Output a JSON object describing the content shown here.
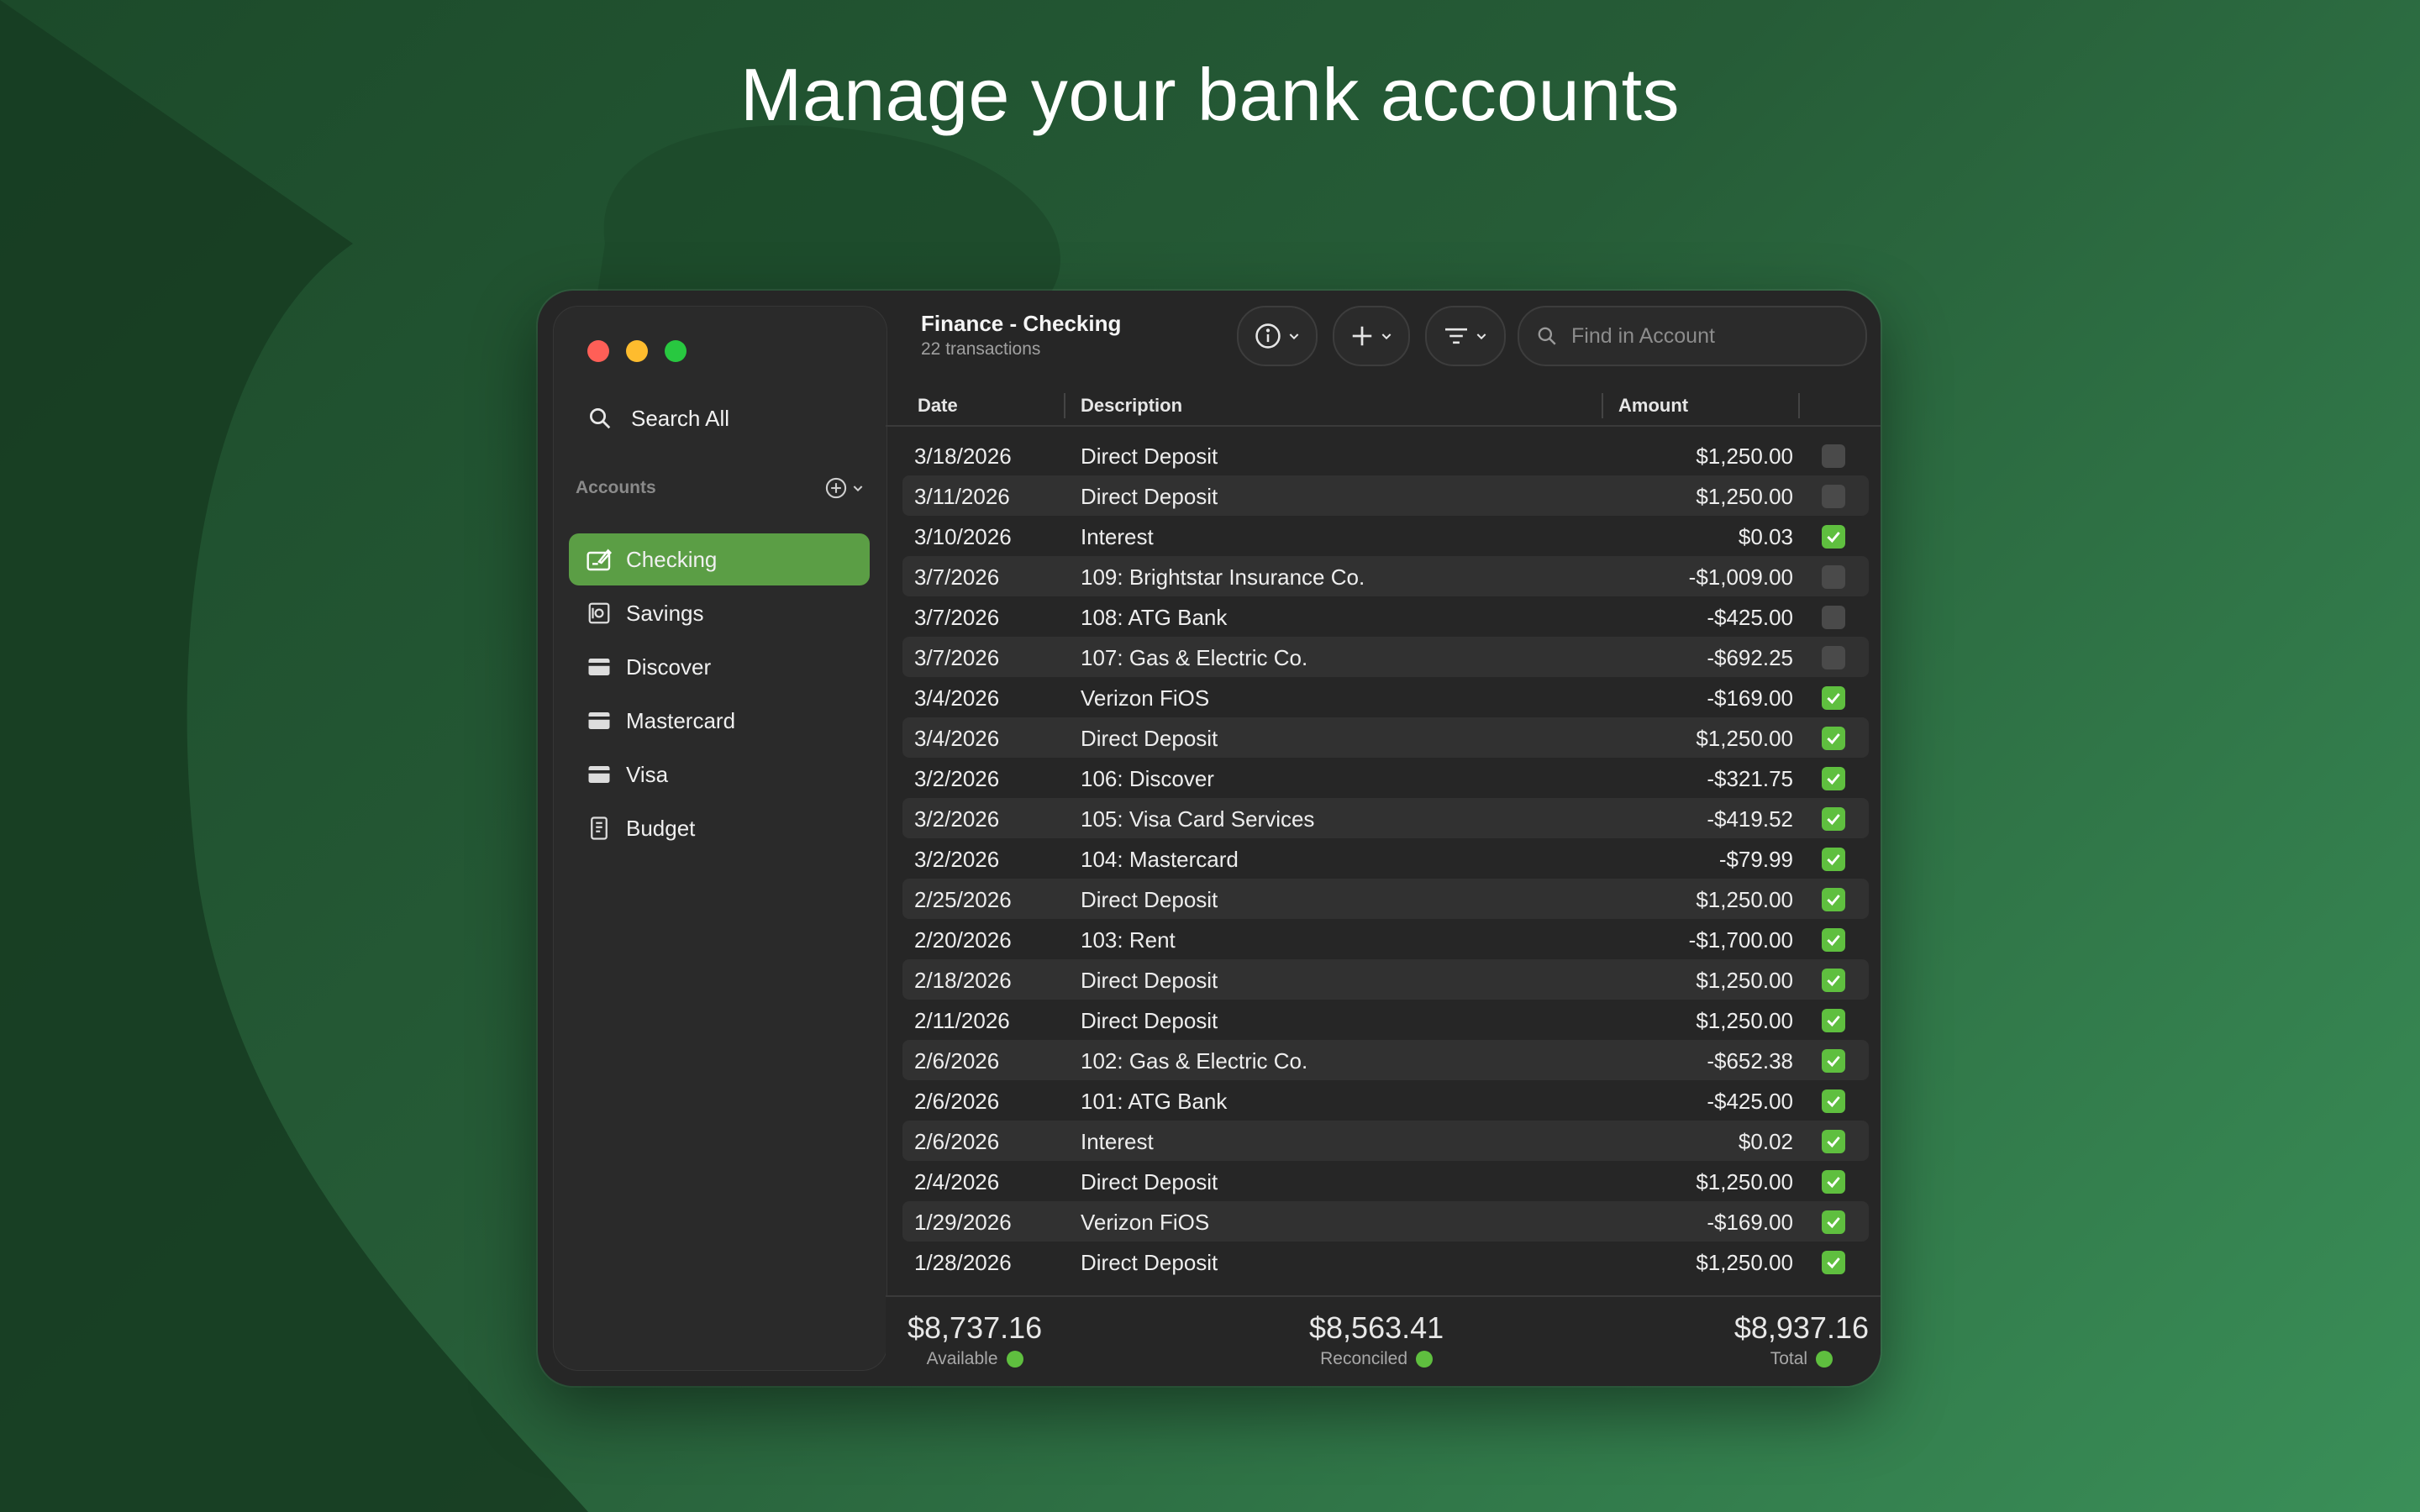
{
  "headline": "Manage your bank accounts",
  "window": {
    "title": "Finance - Checking",
    "subtitle": "22 transactions"
  },
  "sidebar": {
    "search_all": "Search All",
    "section_label": "Accounts",
    "accounts": [
      {
        "label": "Checking",
        "icon": "checkbook-icon",
        "active": true
      },
      {
        "label": "Savings",
        "icon": "safe-icon"
      },
      {
        "label": "Discover",
        "icon": "credit-card-icon"
      },
      {
        "label": "Mastercard",
        "icon": "credit-card-icon"
      },
      {
        "label": "Visa",
        "icon": "credit-card-icon"
      },
      {
        "label": "Budget",
        "icon": "budget-sheet-icon"
      }
    ]
  },
  "toolbar": {
    "search_placeholder": "Find in Account"
  },
  "table": {
    "columns": [
      "Date",
      "Description",
      "Amount"
    ],
    "rows": [
      {
        "date": "3/18/2026",
        "desc": "Direct Deposit",
        "amount": "$1,250.00",
        "cleared": false
      },
      {
        "date": "3/11/2026",
        "desc": "Direct Deposit",
        "amount": "$1,250.00",
        "cleared": false
      },
      {
        "date": "3/10/2026",
        "desc": "Interest",
        "amount": "$0.03",
        "cleared": true
      },
      {
        "date": "3/7/2026",
        "desc": "109: Brightstar Insurance Co.",
        "amount": "-$1,009.00",
        "cleared": false
      },
      {
        "date": "3/7/2026",
        "desc": "108: ATG Bank",
        "amount": "-$425.00",
        "cleared": false
      },
      {
        "date": "3/7/2026",
        "desc": "107: Gas & Electric Co.",
        "amount": "-$692.25",
        "cleared": false
      },
      {
        "date": "3/4/2026",
        "desc": "Verizon FiOS",
        "amount": "-$169.00",
        "cleared": true
      },
      {
        "date": "3/4/2026",
        "desc": "Direct Deposit",
        "amount": "$1,250.00",
        "cleared": true
      },
      {
        "date": "3/2/2026",
        "desc": "106: Discover",
        "amount": "-$321.75",
        "cleared": true
      },
      {
        "date": "3/2/2026",
        "desc": "105: Visa Card Services",
        "amount": "-$419.52",
        "cleared": true
      },
      {
        "date": "3/2/2026",
        "desc": "104: Mastercard",
        "amount": "-$79.99",
        "cleared": true
      },
      {
        "date": "2/25/2026",
        "desc": "Direct Deposit",
        "amount": "$1,250.00",
        "cleared": true
      },
      {
        "date": "2/20/2026",
        "desc": "103: Rent",
        "amount": "-$1,700.00",
        "cleared": true
      },
      {
        "date": "2/18/2026",
        "desc": "Direct Deposit",
        "amount": "$1,250.00",
        "cleared": true
      },
      {
        "date": "2/11/2026",
        "desc": "Direct Deposit",
        "amount": "$1,250.00",
        "cleared": true
      },
      {
        "date": "2/6/2026",
        "desc": "102: Gas & Electric Co.",
        "amount": "-$652.38",
        "cleared": true
      },
      {
        "date": "2/6/2026",
        "desc": "101: ATG Bank",
        "amount": "-$425.00",
        "cleared": true
      },
      {
        "date": "2/6/2026",
        "desc": "Interest",
        "amount": "$0.02",
        "cleared": true
      },
      {
        "date": "2/4/2026",
        "desc": "Direct Deposit",
        "amount": "$1,250.00",
        "cleared": true
      },
      {
        "date": "1/29/2026",
        "desc": "Verizon FiOS",
        "amount": "-$169.00",
        "cleared": true
      },
      {
        "date": "1/28/2026",
        "desc": "Direct Deposit",
        "amount": "$1,250.00",
        "cleared": true
      }
    ]
  },
  "footer": {
    "available_value": "$8,737.16",
    "available_label": "Available",
    "reconciled_value": "$8,563.41",
    "reconciled_label": "Reconciled",
    "total_value": "$8,937.16",
    "total_label": "Total"
  },
  "colors": {
    "accent": "#5b9e45",
    "cleared": "#5fbf3f"
  }
}
